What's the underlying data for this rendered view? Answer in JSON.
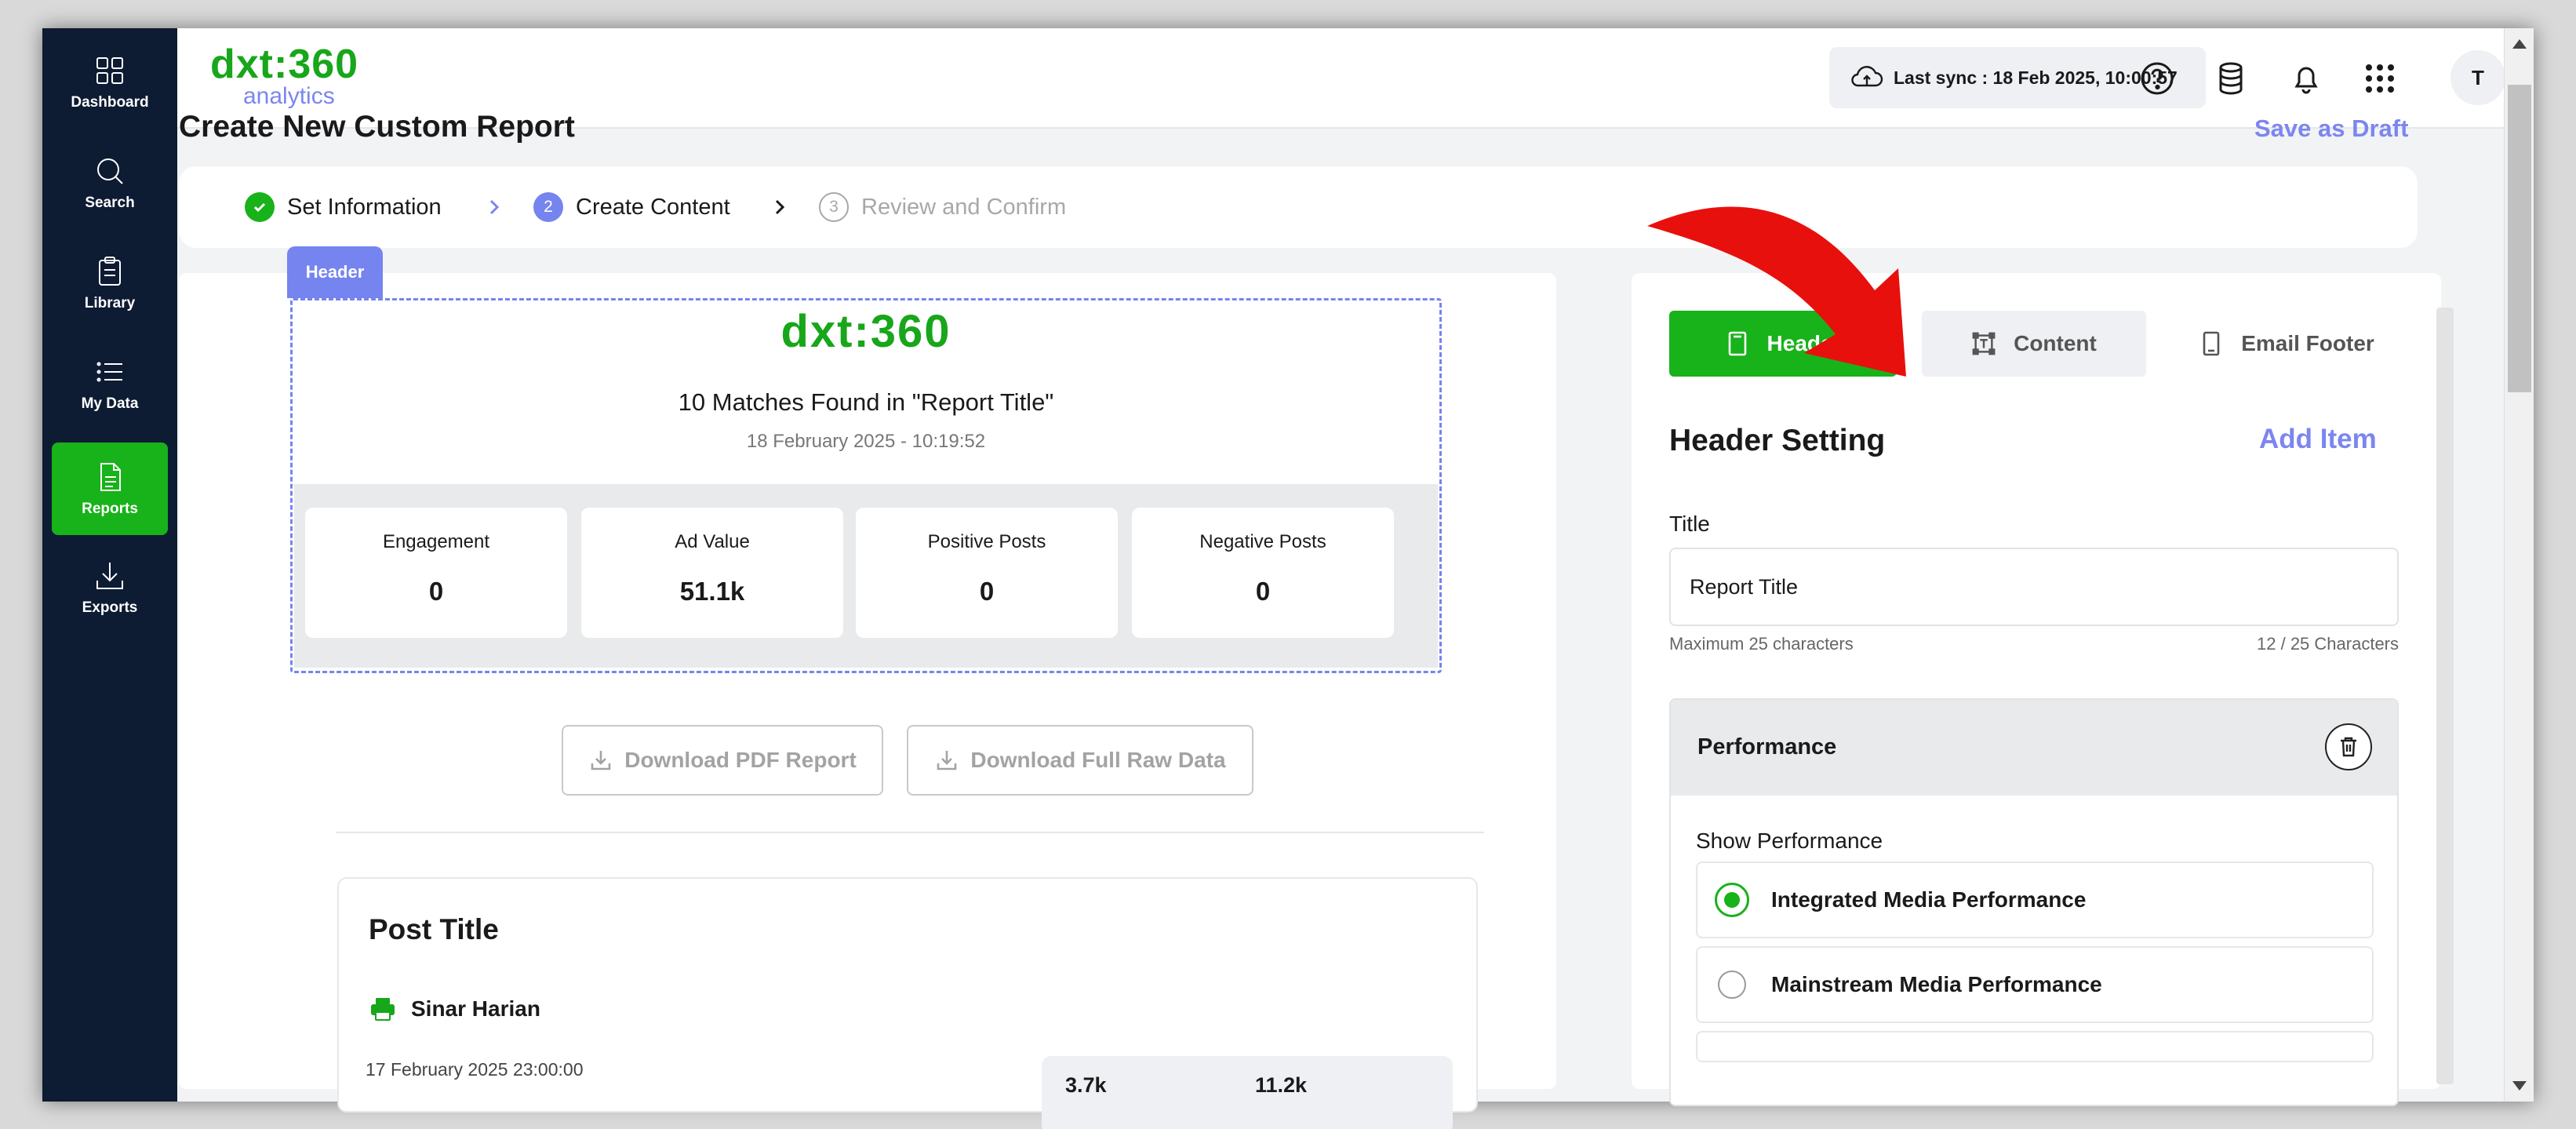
{
  "sidebar": {
    "items": [
      {
        "label": "Dashboard",
        "icon": "grid-icon",
        "active": false
      },
      {
        "label": "Search",
        "icon": "search-icon",
        "active": false
      },
      {
        "label": "Library",
        "icon": "clipboard-icon",
        "active": false
      },
      {
        "label": "My Data",
        "icon": "list-icon",
        "active": false
      },
      {
        "label": "Reports",
        "icon": "document-icon",
        "active": true
      },
      {
        "label": "Exports",
        "icon": "download-icon",
        "active": false
      }
    ]
  },
  "topbar": {
    "logo_main": "dxt:360",
    "logo_sub": "analytics",
    "last_sync": "Last sync : 18 Feb 2025, 10:00:57",
    "avatar_initial": "T",
    "icons": [
      "help-icon",
      "database-icon",
      "bell-icon",
      "apps-grid-icon"
    ]
  },
  "page": {
    "title": "Create New Custom Report",
    "save_draft": "Save as Draft"
  },
  "stepper": {
    "steps": [
      {
        "number": "1",
        "label": "Set Information",
        "state": "done"
      },
      {
        "number": "2",
        "label": "Create Content",
        "state": "current"
      },
      {
        "number": "3",
        "label": "Review and Confirm",
        "state": "upcoming"
      }
    ]
  },
  "preview": {
    "header_tag": "Header",
    "logo": "dxt:360",
    "title": "10 Matches Found in  \"Report Title\"",
    "date": "18 February 2025 - 10:19:52",
    "stats": [
      {
        "label": "Engagement",
        "value": "0"
      },
      {
        "label": "Ad Value",
        "value": "51.1k"
      },
      {
        "label": "Positive Posts",
        "value": "0"
      },
      {
        "label": "Negative Posts",
        "value": "0"
      }
    ],
    "download_pdf": "Download PDF Report",
    "download_raw": "Download Full Raw Data",
    "post": {
      "title": "Post Title",
      "source": "Sinar Harian",
      "date": "17 February 2025 23:00:00",
      "metric_1": "3.7k",
      "metric_2": "11.2k"
    }
  },
  "panel": {
    "tabs": [
      {
        "label": "Header",
        "icon": "tablet-icon",
        "active": true
      },
      {
        "label": "Content",
        "icon": "text-box-icon",
        "active": false
      },
      {
        "label": "Email Footer",
        "icon": "phone-icon",
        "active": false
      }
    ],
    "section_title": "Header Setting",
    "add_item": "Add Item",
    "title_label": "Title",
    "title_value": "Report Title",
    "hint_max": "Maximum 25 characters",
    "hint_count": "12 / 25 Characters",
    "performance": {
      "title": "Performance",
      "show_label": "Show Performance",
      "options": [
        {
          "label": "Integrated Media Performance",
          "selected": true
        },
        {
          "label": "Mainstream Media Performance",
          "selected": false
        }
      ]
    }
  },
  "colors": {
    "brand_green": "#18b21a",
    "accent_purple": "#7b86ef",
    "sidebar_navy": "#0d1b33",
    "annotation_red": "#e8100c"
  }
}
